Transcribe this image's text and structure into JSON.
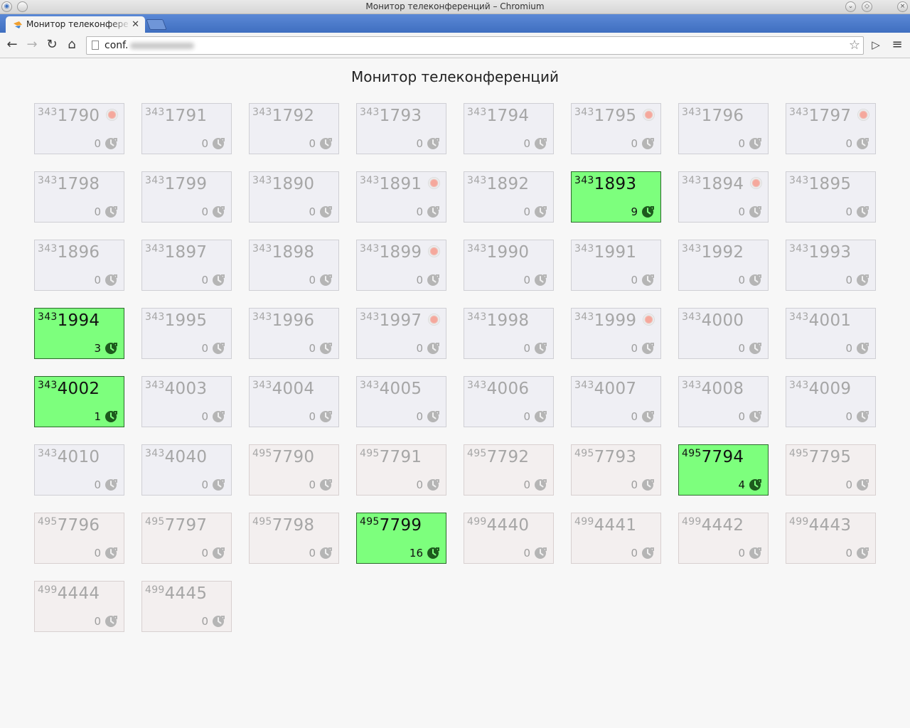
{
  "window": {
    "title": "Монитор телеконференций – Chromium"
  },
  "tab": {
    "label": "Монитор телеконфере"
  },
  "toolbar": {
    "url": "conf."
  },
  "page": {
    "title": "Монитор телеконференций"
  },
  "rooms": [
    {
      "prefix": "343",
      "number": "1790",
      "count": "0",
      "active": false,
      "recording": true
    },
    {
      "prefix": "343",
      "number": "1791",
      "count": "0",
      "active": false,
      "recording": false
    },
    {
      "prefix": "343",
      "number": "1792",
      "count": "0",
      "active": false,
      "recording": false
    },
    {
      "prefix": "343",
      "number": "1793",
      "count": "0",
      "active": false,
      "recording": false
    },
    {
      "prefix": "343",
      "number": "1794",
      "count": "0",
      "active": false,
      "recording": false
    },
    {
      "prefix": "343",
      "number": "1795",
      "count": "0",
      "active": false,
      "recording": true
    },
    {
      "prefix": "343",
      "number": "1796",
      "count": "0",
      "active": false,
      "recording": false
    },
    {
      "prefix": "343",
      "number": "1797",
      "count": "0",
      "active": false,
      "recording": true
    },
    {
      "prefix": "343",
      "number": "1798",
      "count": "0",
      "active": false,
      "recording": false
    },
    {
      "prefix": "343",
      "number": "1799",
      "count": "0",
      "active": false,
      "recording": false
    },
    {
      "prefix": "343",
      "number": "1890",
      "count": "0",
      "active": false,
      "recording": false
    },
    {
      "prefix": "343",
      "number": "1891",
      "count": "0",
      "active": false,
      "recording": true
    },
    {
      "prefix": "343",
      "number": "1892",
      "count": "0",
      "active": false,
      "recording": false
    },
    {
      "prefix": "343",
      "number": "1893",
      "count": "9",
      "active": true,
      "recording": false
    },
    {
      "prefix": "343",
      "number": "1894",
      "count": "0",
      "active": false,
      "recording": true
    },
    {
      "prefix": "343",
      "number": "1895",
      "count": "0",
      "active": false,
      "recording": false
    },
    {
      "prefix": "343",
      "number": "1896",
      "count": "0",
      "active": false,
      "recording": false
    },
    {
      "prefix": "343",
      "number": "1897",
      "count": "0",
      "active": false,
      "recording": false
    },
    {
      "prefix": "343",
      "number": "1898",
      "count": "0",
      "active": false,
      "recording": false
    },
    {
      "prefix": "343",
      "number": "1899",
      "count": "0",
      "active": false,
      "recording": true
    },
    {
      "prefix": "343",
      "number": "1990",
      "count": "0",
      "active": false,
      "recording": false
    },
    {
      "prefix": "343",
      "number": "1991",
      "count": "0",
      "active": false,
      "recording": false
    },
    {
      "prefix": "343",
      "number": "1992",
      "count": "0",
      "active": false,
      "recording": false
    },
    {
      "prefix": "343",
      "number": "1993",
      "count": "0",
      "active": false,
      "recording": false
    },
    {
      "prefix": "343",
      "number": "1994",
      "count": "3",
      "active": true,
      "recording": false
    },
    {
      "prefix": "343",
      "number": "1995",
      "count": "0",
      "active": false,
      "recording": false
    },
    {
      "prefix": "343",
      "number": "1996",
      "count": "0",
      "active": false,
      "recording": false
    },
    {
      "prefix": "343",
      "number": "1997",
      "count": "0",
      "active": false,
      "recording": true
    },
    {
      "prefix": "343",
      "number": "1998",
      "count": "0",
      "active": false,
      "recording": false
    },
    {
      "prefix": "343",
      "number": "1999",
      "count": "0",
      "active": false,
      "recording": true
    },
    {
      "prefix": "343",
      "number": "4000",
      "count": "0",
      "active": false,
      "recording": false
    },
    {
      "prefix": "343",
      "number": "4001",
      "count": "0",
      "active": false,
      "recording": false
    },
    {
      "prefix": "343",
      "number": "4002",
      "count": "1",
      "active": true,
      "recording": false
    },
    {
      "prefix": "343",
      "number": "4003",
      "count": "0",
      "active": false,
      "recording": false
    },
    {
      "prefix": "343",
      "number": "4004",
      "count": "0",
      "active": false,
      "recording": false
    },
    {
      "prefix": "343",
      "number": "4005",
      "count": "0",
      "active": false,
      "recording": false
    },
    {
      "prefix": "343",
      "number": "4006",
      "count": "0",
      "active": false,
      "recording": false
    },
    {
      "prefix": "343",
      "number": "4007",
      "count": "0",
      "active": false,
      "recording": false
    },
    {
      "prefix": "343",
      "number": "4008",
      "count": "0",
      "active": false,
      "recording": false
    },
    {
      "prefix": "343",
      "number": "4009",
      "count": "0",
      "active": false,
      "recording": false
    },
    {
      "prefix": "343",
      "number": "4010",
      "count": "0",
      "active": false,
      "recording": false
    },
    {
      "prefix": "343",
      "number": "4040",
      "count": "0",
      "active": false,
      "recording": false
    },
    {
      "prefix": "495",
      "number": "7790",
      "count": "0",
      "active": false,
      "recording": false
    },
    {
      "prefix": "495",
      "number": "7791",
      "count": "0",
      "active": false,
      "recording": false
    },
    {
      "prefix": "495",
      "number": "7792",
      "count": "0",
      "active": false,
      "recording": false
    },
    {
      "prefix": "495",
      "number": "7793",
      "count": "0",
      "active": false,
      "recording": false
    },
    {
      "prefix": "495",
      "number": "7794",
      "count": "4",
      "active": true,
      "recording": false
    },
    {
      "prefix": "495",
      "number": "7795",
      "count": "0",
      "active": false,
      "recording": false
    },
    {
      "prefix": "495",
      "number": "7796",
      "count": "0",
      "active": false,
      "recording": false
    },
    {
      "prefix": "495",
      "number": "7797",
      "count": "0",
      "active": false,
      "recording": false
    },
    {
      "prefix": "495",
      "number": "7798",
      "count": "0",
      "active": false,
      "recording": false
    },
    {
      "prefix": "495",
      "number": "7799",
      "count": "16",
      "active": true,
      "recording": false
    },
    {
      "prefix": "499",
      "number": "4440",
      "count": "0",
      "active": false,
      "recording": false
    },
    {
      "prefix": "499",
      "number": "4441",
      "count": "0",
      "active": false,
      "recording": false
    },
    {
      "prefix": "499",
      "number": "4442",
      "count": "0",
      "active": false,
      "recording": false
    },
    {
      "prefix": "499",
      "number": "4443",
      "count": "0",
      "active": false,
      "recording": false
    },
    {
      "prefix": "499",
      "number": "4444",
      "count": "0",
      "active": false,
      "recording": false
    },
    {
      "prefix": "499",
      "number": "4445",
      "count": "0",
      "active": false,
      "recording": false
    }
  ],
  "colors": {
    "active": "#7dff7d",
    "inactive": "#efeff4",
    "recording": "#f5a89c"
  }
}
